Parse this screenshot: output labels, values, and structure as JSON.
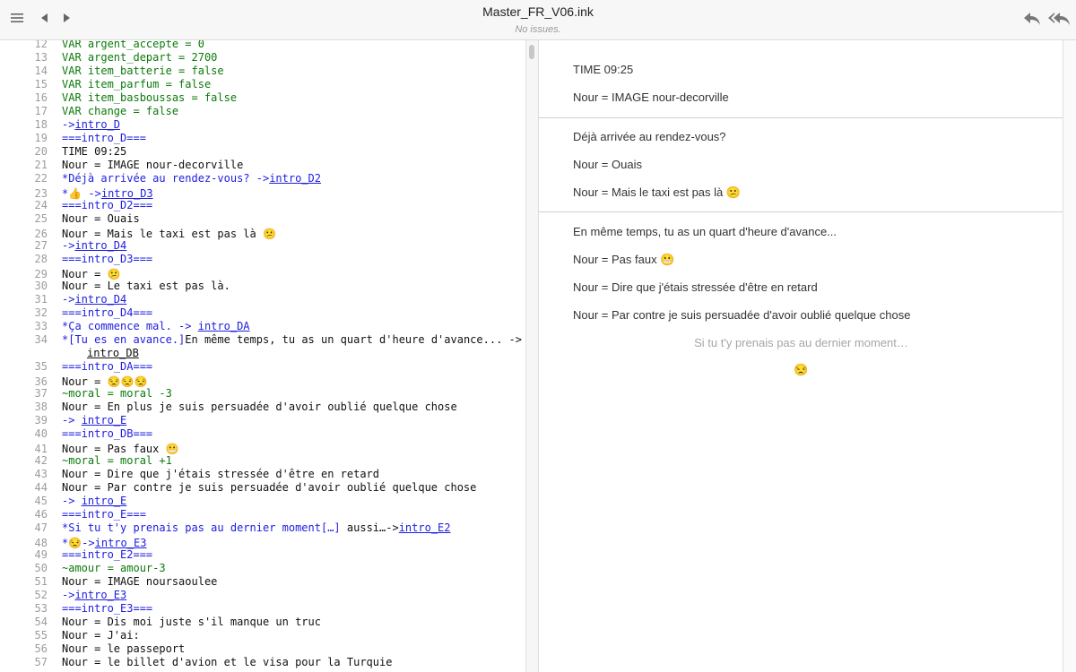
{
  "window": {
    "title": "Master_FR_V06.ink",
    "status": "No issues.",
    "menu_icon": "hamburger-icon",
    "back_icon": "triangle-left-icon",
    "forward_icon": "triangle-right-icon",
    "rewind_icon": "reply-icon",
    "restart_icon": "reply-all-icon"
  },
  "editor": {
    "line_numbers": [
      "12",
      "13",
      "14",
      "15",
      "16",
      "17",
      "18",
      "19",
      "20",
      "21",
      "22",
      "23",
      "24",
      "25",
      "26",
      "27",
      "28",
      "29",
      "30",
      "31",
      "32",
      "33",
      "34",
      "35",
      "36",
      "37",
      "38",
      "39",
      "40",
      "41",
      "42",
      "43",
      "44",
      "45",
      "46",
      "47",
      "48",
      "49",
      "50",
      "51",
      "52",
      "53",
      "54",
      "55",
      "56",
      "57"
    ],
    "lines": {
      "l12": "VAR argent_accepte = 0",
      "l13": "VAR argent_depart = 2700",
      "l14": "VAR item_batterie = false",
      "l15": "VAR item_parfum = false",
      "l16": "VAR item_basboussas = false",
      "l17": "VAR change = false",
      "l18a": "->",
      "l18b": "intro_D",
      "l19": "===intro_D===",
      "l20": "TIME 09:25",
      "l21": "Nour = IMAGE nour-decorville",
      "l22a": "*Déjà arrivée au rendez-vous? ->",
      "l22b": "intro_D2",
      "l23a": "*👍 ->",
      "l23b": "intro_D3",
      "l24": "===intro_D2===",
      "l25": "Nour = Ouais",
      "l26": "Nour = Mais le taxi est pas là 😕",
      "l27a": "->",
      "l27b": "intro_D4",
      "l28": "===intro_D3===",
      "l29": "Nour = 😕",
      "l30": "Nour = Le taxi est pas là.",
      "l31a": "->",
      "l31b": "intro_D4",
      "l32": "===intro_D4===",
      "l33a": "*Ça commence mal. -> ",
      "l33b": "intro_DA",
      "l34a": "*[Tu es en avance.]",
      "l34b": "En même temps, tu as un quart d'heure d'avance... ->",
      "l34c": "intro_DB",
      "l35": "===intro_DA===",
      "l36": "Nour = 😒😒😒",
      "l37": "~moral = moral -3",
      "l38": "Nour = En plus je suis persuadée d'avoir oublié quelque chose",
      "l39a": "-> ",
      "l39b": "intro_E",
      "l40": "===intro_DB===",
      "l41": "Nour = Pas faux 😬",
      "l42": "~moral = moral +1",
      "l43": "Nour = Dire que j'étais stressée d'être en retard",
      "l44": "Nour = Par contre je suis persuadée d'avoir oublié quelque chose",
      "l45a": "-> ",
      "l45b": "intro_E",
      "l46": "===intro_E===",
      "l47a": "*Si tu t'y prenais pas au dernier moment",
      "l47b": "[…]",
      "l47c": " aussi…->",
      "l47d": "intro_E2",
      "l48a": "*😒->",
      "l48b": "intro_E3",
      "l49": "===intro_E2===",
      "l50": "~amour = amour-3",
      "l51": "Nour = IMAGE noursaoulee",
      "l52a": "->",
      "l52b": "intro_E3",
      "l53": "===intro_E3===",
      "l54": "Nour = Dis moi juste s'il manque un truc",
      "l55": "Nour = J'ai:",
      "l56": "Nour = le passeport",
      "l57": "Nour = le billet d'avion et le visa pour la Turquie"
    }
  },
  "player": {
    "block1": [
      "TIME 09:25",
      "Nour = IMAGE nour-decorville"
    ],
    "block2": [
      "Déjà arrivée au rendez-vous?",
      "Nour = Ouais",
      "Nour = Mais le taxi est pas là 😕"
    ],
    "block3": [
      "En même temps, tu as un quart d'heure d'avance...",
      "Nour = Pas faux 😬",
      "Nour = Dire que j'étais stressée d'être en retard",
      "Nour = Par contre je suis persuadée d'avoir oublié quelque chose"
    ],
    "choices": [
      "Si tu t'y prenais pas au dernier moment…",
      "😒"
    ]
  }
}
